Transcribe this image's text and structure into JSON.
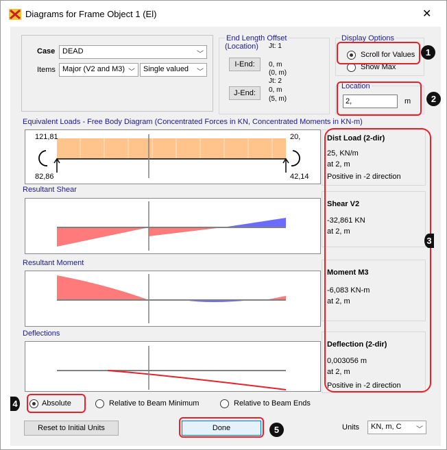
{
  "window": {
    "title": "Diagrams for Frame Object 1  (El)",
    "close_glyph": "✕",
    "app_icon": "csi-sap-icon"
  },
  "case": {
    "case_label": "Case",
    "case_value": "DEAD",
    "items_label": "Items",
    "items_value": "Major (V2 and M3)",
    "value_type": "Single valued"
  },
  "end_offset": {
    "title_line1": "End Length Offset",
    "title_line2": "(Location)",
    "i_end_button": "I-End:",
    "j_end_button": "J-End:",
    "jt1": "Jt:  1",
    "i_len": "0, m",
    "i_loc": "(0, m)",
    "jt2": "Jt:  2",
    "j_len": "0, m",
    "j_loc": "(5, m)"
  },
  "display_options": {
    "title": "Display Options",
    "scroll_label": "Scroll for Values",
    "showmax_label": "Show Max",
    "selected": "scroll"
  },
  "location": {
    "title": "Location",
    "value": "2,",
    "unit": "m"
  },
  "equiv_loads": {
    "title": "Equivalent Loads - Free Body Diagram  (Concentrated Forces in KN, Concentrated Moments in KN-m)",
    "top_left": "121,81",
    "top_right": "20,",
    "bottom_left": "82,86",
    "bottom_right": "42,14",
    "load_color": "#ffc48c"
  },
  "shear": {
    "title": "Resultant Shear"
  },
  "moment": {
    "title": "Resultant Moment"
  },
  "deflection": {
    "title": "Deflections"
  },
  "colors": {
    "negative_fill": "#ff7a7a",
    "positive_fill": "#6b6bff",
    "annotation_red": "#e8202a",
    "group_title_blue": "#1a1a8e"
  },
  "info": {
    "dist_load": {
      "title": "Dist Load (2-dir)",
      "line1": "25, KN/m",
      "line2": "at 2, m",
      "line3": "Positive in -2 direction"
    },
    "shear_v2": {
      "title": "Shear V2",
      "line1": "-32,861 KN",
      "line2": "at 2, m"
    },
    "moment_m3": {
      "title": "Moment M3",
      "line1": "-6,083 KN-m",
      "line2": "at 2, m"
    },
    "deflection": {
      "title": "Deflection (2-dir)",
      "line1": "0,003056 m",
      "line2": "at 2, m",
      "line3": "Positive in -2 direction"
    }
  },
  "deflection_mode": {
    "absolute": "Absolute",
    "rel_min": "Relative to Beam Minimum",
    "rel_ends": "Relative to Beam Ends",
    "selected": "absolute"
  },
  "footer": {
    "reset_button": "Reset to Initial Units",
    "done_button": "Done",
    "units_label": "Units",
    "units_value": "KN, m, C"
  },
  "badges": [
    "1",
    "2",
    "3",
    "4",
    "5"
  ]
}
